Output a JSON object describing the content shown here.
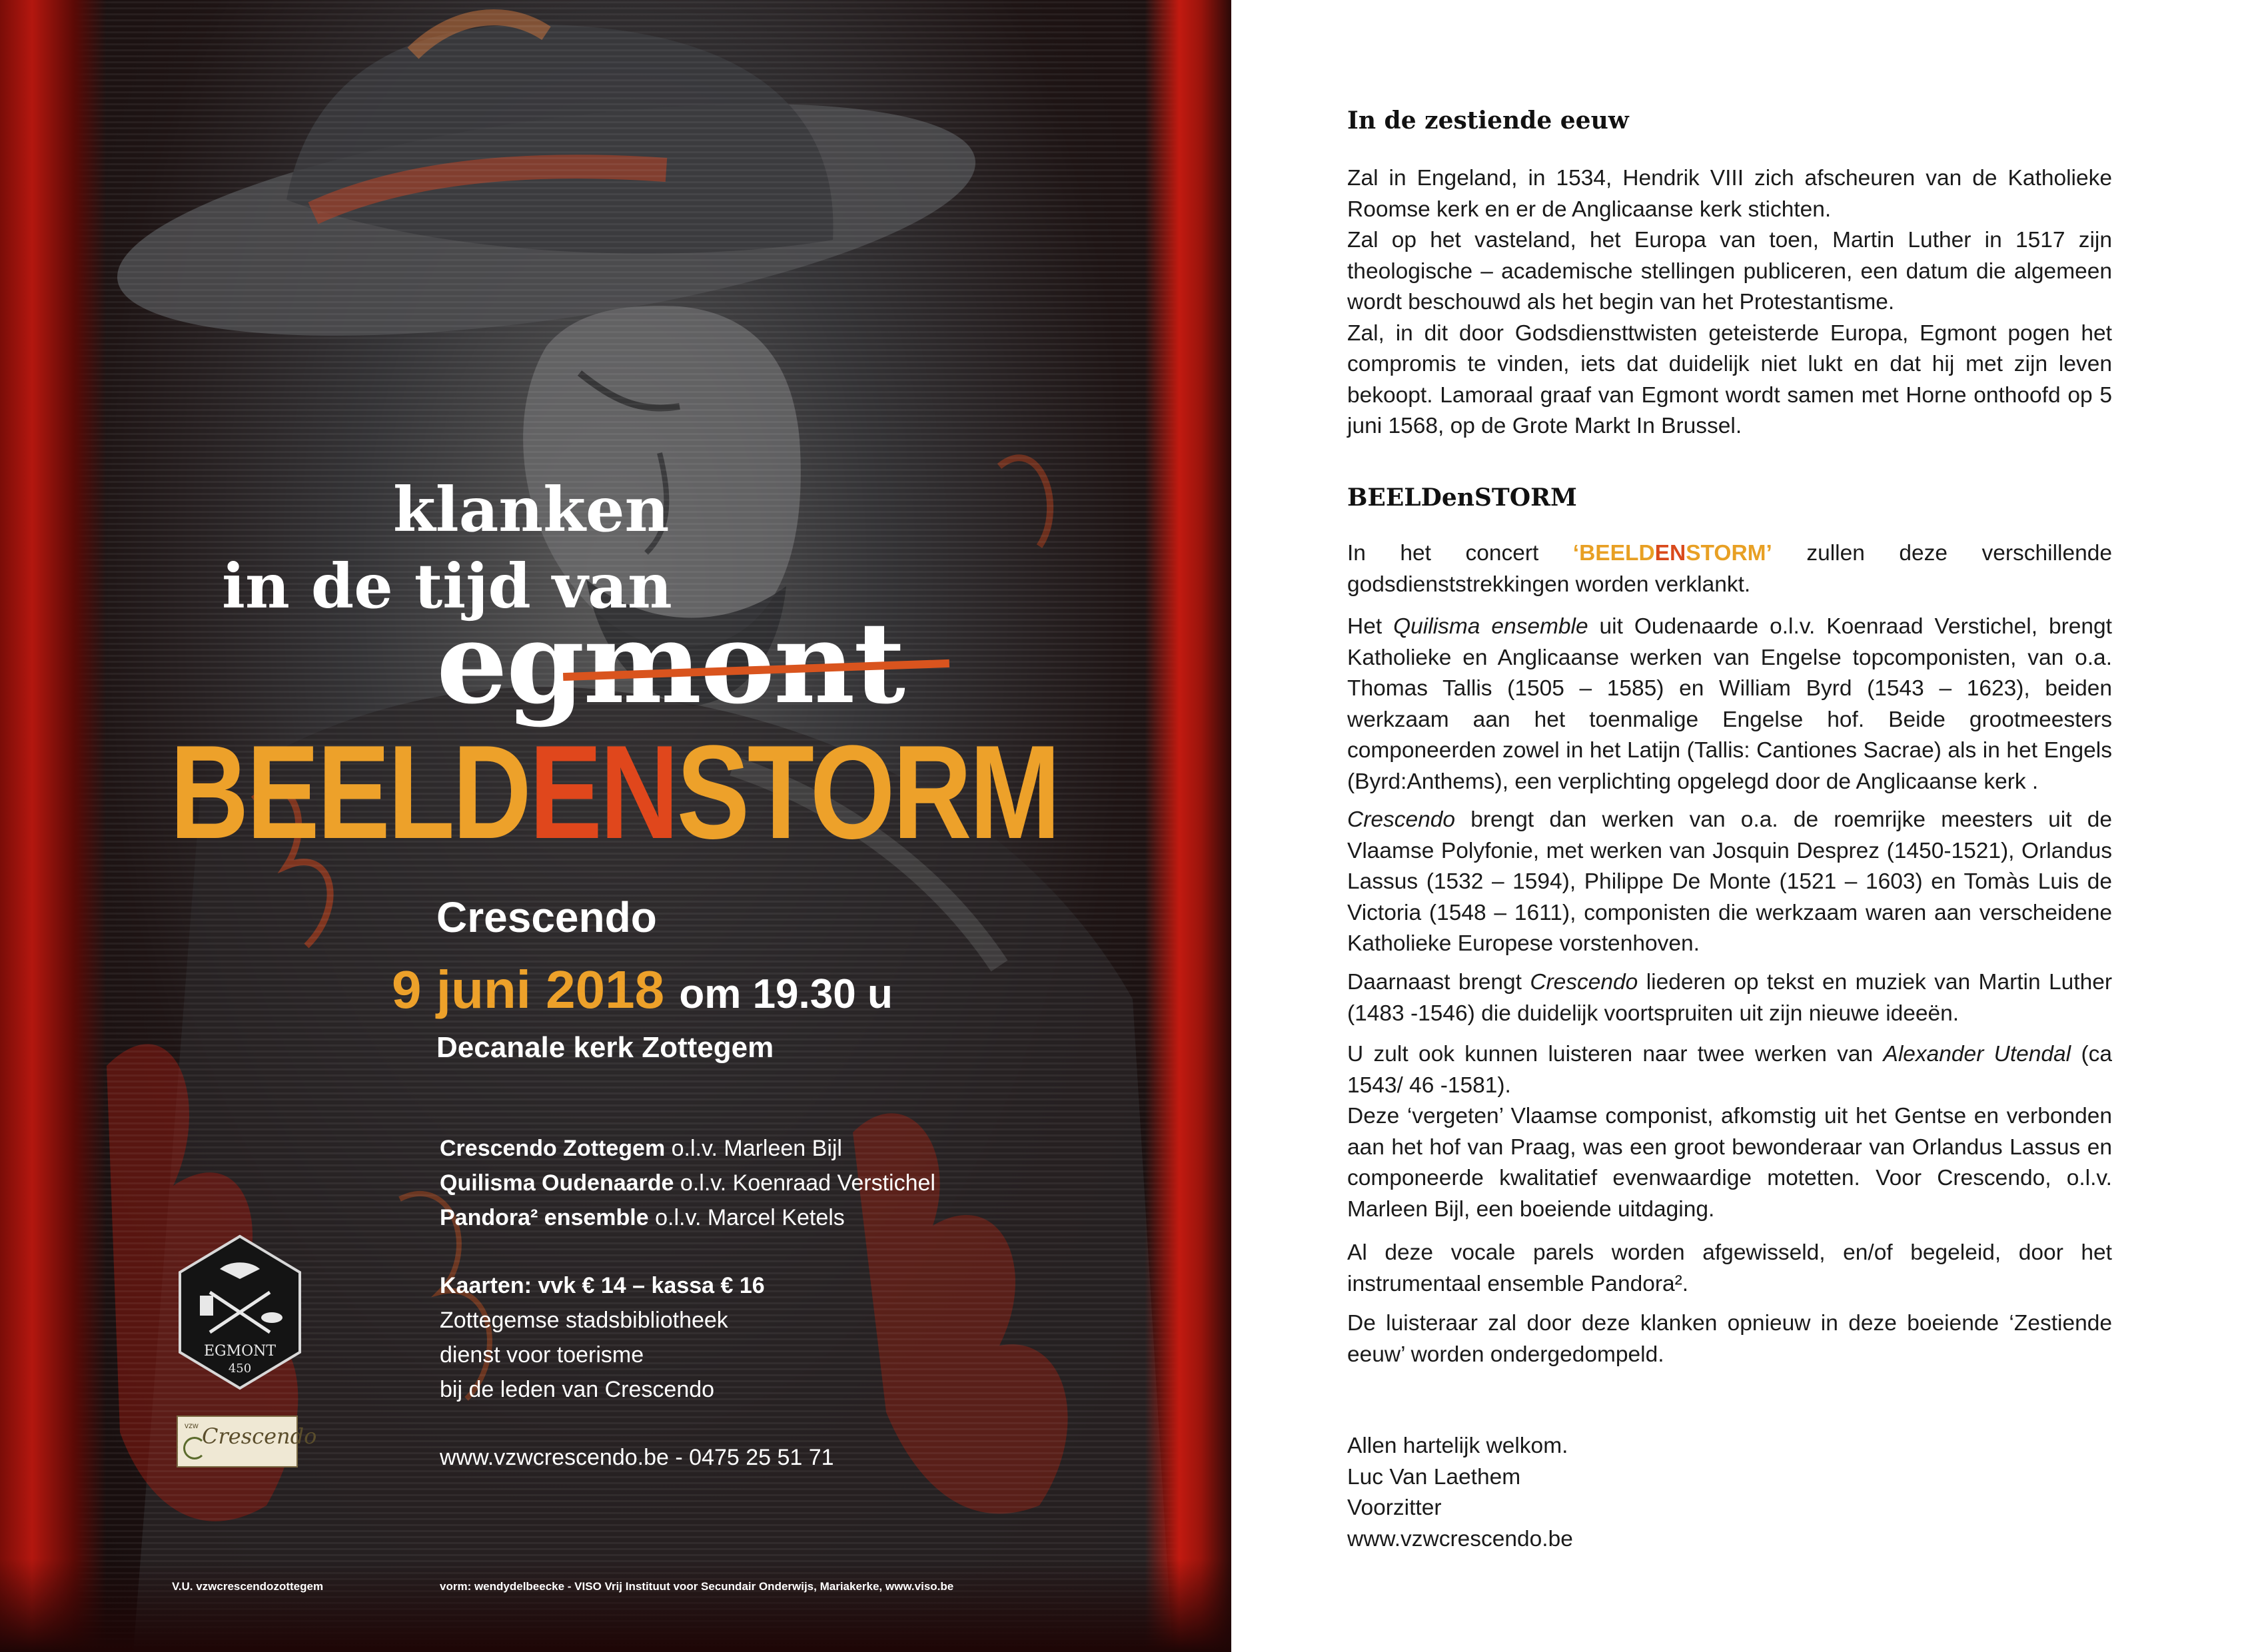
{
  "poster": {
    "line_klanken": "klanken",
    "line_tijd": "in de tijd van",
    "line_egmont": "egmont",
    "beeldenstorm": {
      "part1": "BEELD",
      "part2": "EN",
      "part3": "STORM"
    },
    "ensemble": "Crescendo",
    "date": "9 juni 2018",
    "time": "om 19.30 u",
    "venue": "Decanale kerk Zottegem",
    "lineup": [
      {
        "name": "Crescendo Zottegem",
        "leader": "o.l.v. Marleen Bijl"
      },
      {
        "name": "Quilisma Oudenaarde",
        "leader": "o.l.v. Koenraad Verstichel"
      },
      {
        "name": "Pandora² ensemble",
        "leader": "o.l.v. Marcel Ketels"
      }
    ],
    "tickets": "Kaarten: vvk € 14 – kassa € 16",
    "sales": [
      "Zottegemse stadsbibliotheek",
      "dienst voor toerisme",
      "bij de leden van Crescendo"
    ],
    "contact": "www.vzwcrescendo.be - 0475 25 51 71",
    "badge": {
      "line1": "EGMONT",
      "line2": "450"
    },
    "logo": {
      "small": "vzw",
      "name": "Crescendo"
    },
    "footer_vu": "V.U. vzwcrescendozottegem",
    "footer_design": "vorm: wendydelbeecke - VISO Vrij Instituut voor Secundair Onderwijs, Mariakerke, www.viso.be",
    "colors": {
      "orange": "#eda12a",
      "red_orange": "#e0471c",
      "frame_red": "#b3170f"
    }
  },
  "text": {
    "heading1": "In de zestiende eeuw",
    "para1": [
      "Zal in Engeland, in 1534, Hendrik VIII zich afscheuren van de Katholieke Roomse kerk en er de Anglicaanse kerk stichten.",
      "Zal op het vasteland, het Europa van toen, Martin Luther in 1517 zijn theologische – academische stellingen publiceren, een datum die algemeen wordt beschouwd als het begin van het Protestantisme.",
      "Zal, in dit door Godsdiensttwisten geteisterde Europa, Egmont pogen het compromis te vinden, iets dat duidelijk niet lukt en dat hij met zijn leven bekoopt. Lamoraal graaf van Egmont wordt samen met Horne onthoofd op 5 juni 1568, op de Grote Markt In Brussel."
    ],
    "heading2": "BEELDenSTORM",
    "concert": {
      "before": "In het concert ",
      "q1": "‘BEELD",
      "q2": "EN",
      "q3": "STORM’",
      "after": " zullen deze verschillende godsdienststrekkingen worden verklankt."
    },
    "quilisma": {
      "a": "Het ",
      "b": "Quilisma ensemble",
      "c": " uit Oudenaarde o.l.v. Koenraad Verstichel, brengt Katholieke en Anglicaanse werken van Engelse topcomponisten, van o.a. Thomas Tallis (1505 – 1585) en William Byrd (1543 – 1623), beiden werkzaam aan het toenmalige Engelse hof. Beide grootmeesters componeerden zowel in het Latijn (Tallis: Cantiones Sacrae) als in het Engels (Byrd:Anthems), een verplichting opgelegd door de Anglicaanse kerk ."
    },
    "crescendo": {
      "a": "Crescendo",
      "b": " brengt dan werken van o.a. de roemrijke meesters uit de Vlaamse Polyfonie, met werken van Josquin Desprez (1450-1521), Orlandus Lassus (1532 – 1594), Philippe De Monte (1521 – 1603) en Tomàs Luis de Victoria (1548 – 1611), componisten die werkzaam waren aan verscheidene Katholieke Europese vorstenhoven."
    },
    "luther": {
      "a": "Daarnaast brengt ",
      "b": "Crescendo",
      "c": " liederen op tekst en muziek van Martin Luther (1483 -1546) die  duidelijk voortspruiten uit zijn nieuwe ideeën."
    },
    "utendal": {
      "a": "U zult ook kunnen luisteren naar twee werken van ",
      "b": "Alexander Utendal",
      "c": " (ca 1543/ 46 -1581).",
      "d": "Deze ‘vergeten’ Vlaamse componist, afkomstig uit het Gentse en verbonden aan het hof van Praag, was een groot bewonderaar van Orlandus Lassus en componeerde kwalitatief evenwaardige motetten. Voor Crescendo, o.l.v. Marleen Bijl, een boeiende uitdaging."
    },
    "pandora": "Al deze vocale parels worden afgewisseld, en/of begeleid, door het instrumentaal ensemble Pandora².",
    "closing": "De luisteraar zal door deze klanken opnieuw in deze boeiende ‘Zestiende eeuw’ worden ondergedompeld.",
    "signoff": [
      "Allen hartelijk welkom.",
      "Luc Van Laethem",
      "Voorzitter",
      "www.vzwcrescendo.be"
    ]
  }
}
